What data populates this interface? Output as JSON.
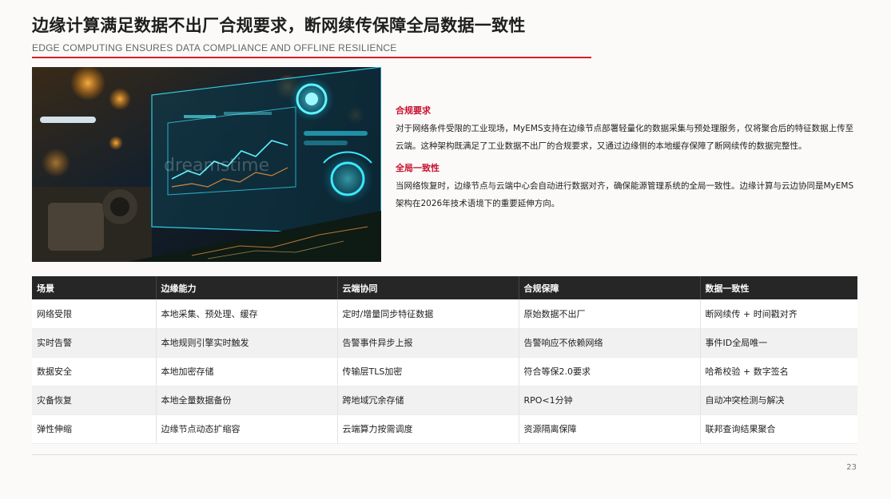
{
  "header": {
    "title": "边缘计算满足数据不出厂合规要求，断网续传保障全局数据一致性",
    "subtitle": "EDGE COMPUTING ENSURES DATA COMPLIANCE AND OFFLINE RESILIENCE"
  },
  "image": {
    "watermark": "dreamstime"
  },
  "sections": [
    {
      "heading": "合规要求",
      "body": "对于网络条件受限的工业现场，MyEMS支持在边缘节点部署轻量化的数据采集与预处理服务，仅将聚合后的特征数据上传至云端。这种架构既满足了工业数据不出厂的合规要求，又通过边缘侧的本地缓存保障了断网续传的数据完整性。"
    },
    {
      "heading": "全局一致性",
      "body": "当网络恢复时，边缘节点与云端中心会自动进行数据对齐，确保能源管理系统的全局一致性。边缘计算与云边协同是MyEMS架构在2026年技术语境下的重要延伸方向。"
    }
  ],
  "table": {
    "headers": [
      "场景",
      "边缘能力",
      "云端协同",
      "合规保障",
      "数据一致性"
    ],
    "rows": [
      [
        "网络受限",
        "本地采集、预处理、缓存",
        "定时/增量同步特征数据",
        "原始数据不出厂",
        "断网续传 + 时间戳对齐"
      ],
      [
        "实时告警",
        "本地规则引擎实时触发",
        "告警事件异步上报",
        "告警响应不依赖网络",
        "事件ID全局唯一"
      ],
      [
        "数据安全",
        "本地加密存储",
        "传输层TLS加密",
        "符合等保2.0要求",
        "哈希校验 + 数字签名"
      ],
      [
        "灾备恢复",
        "本地全量数据备份",
        "跨地域冗余存储",
        "RPO<1分钟",
        "自动冲突检测与解决"
      ],
      [
        "弹性伸缩",
        "边缘节点动态扩缩容",
        "云端算力按需调度",
        "资源隔离保障",
        "联邦查询结果聚合"
      ]
    ]
  },
  "footer": {
    "page_number": "23"
  },
  "colors": {
    "accent": "#d71f26",
    "header_bg": "#262626"
  }
}
